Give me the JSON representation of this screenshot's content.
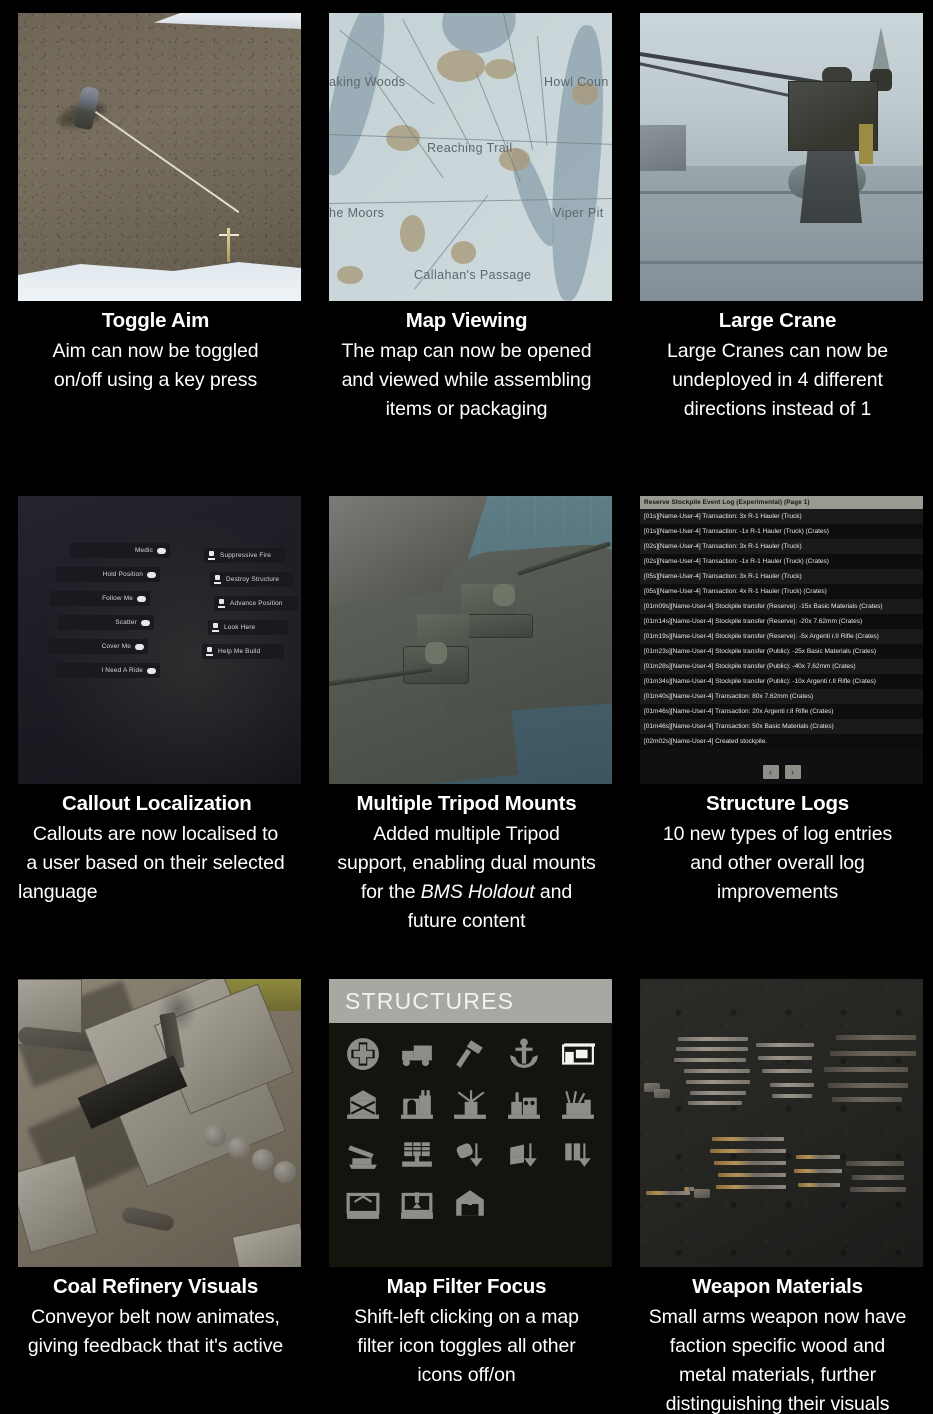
{
  "page": {
    "title": "Patch Notes Feature Highlights",
    "background_color": "#000000",
    "text_color": "#ffffff"
  },
  "cards": [
    {
      "id": "toggle-aim",
      "title": "Toggle Aim",
      "body_lines": [
        "Aim can now be toggled",
        "on/off using a key press"
      ],
      "body": "Aim can now be toggled on/off using a key press",
      "media": "top-down screenshot of a soldier aiming with a line-of-aim indicator on rocky ground"
    },
    {
      "id": "map-viewing",
      "title": "Map Viewing",
      "body_lines": [
        "The map can now be opened",
        "and viewed while assembling",
        "items or packaging"
      ],
      "body": "The map can now be opened and viewed while assembling items or packaging",
      "media": "in-game region map",
      "map_labels": [
        "aking Woods",
        "Howl Coun",
        "Reaching Trail",
        "he Moors",
        "Viper Pit",
        "Callahan's Passage"
      ]
    },
    {
      "id": "large-crane",
      "title": "Large Crane",
      "body_lines": [
        "Large Cranes can now be",
        "undeployed in 4 different",
        "directions instead of 1"
      ],
      "body": "Large Cranes can now be undeployed in 4 different directions instead of 1",
      "media": "large crane on a snowy platform"
    },
    {
      "id": "callout-localization",
      "title": "Callout Localization",
      "title_align": "left",
      "body_lines": [
        "Callouts are now localised to",
        "a user based on their selected",
        "language"
      ],
      "body": "Callouts are now localised to a user based on their selected language",
      "media": "radial callout wheel menu",
      "callouts_left": [
        "Medic",
        "Hold Position",
        "Follow Me",
        "Scatter",
        "Cover Me",
        "I Need A Ride"
      ],
      "callouts_right": [
        "Suppressive Fire",
        "Destroy Structure",
        "Advance Position",
        "Look Here",
        "Help Me Build"
      ]
    },
    {
      "id": "multiple-tripod-mounts",
      "title": "Multiple Tripod Mounts",
      "body_lines": [
        "Added multiple Tripod",
        "support, enabling dual mounts",
        "for the ",
        " and",
        "future content"
      ],
      "body_pre": "Added multiple Tripod support, enabling dual mounts for the ",
      "body_italic": "BMS Holdout",
      "body_post": " and future content",
      "media": "two gunners manning tripod mounts on an armoured vehicle by the sea"
    },
    {
      "id": "structure-logs",
      "title": "Structure Logs",
      "body_lines": [
        "10 new types of log entries",
        "and other overall log",
        "improvements"
      ],
      "body": "10 new types of log entries and other overall log improvements",
      "media": "reserve stockpile event log panel",
      "log": {
        "header": "Reserve Stockpile Event Log (Experimental) (Page 1)",
        "entries": [
          "[01s][Name-User-4] Transaction: 3x R-1 Hauler (Truck)",
          "[01s][Name-User-4] Transaction: -1x R-1 Hauler (Truck) (Crates)",
          "[02s][Name-User-4] Transaction: 3x R-1 Hauler (Truck)",
          "[02s][Name-User-4] Transaction: -1x R-1 Hauler (Truck) (Crates)",
          "[05s][Name-User-4] Transaction: 3x R-1 Hauler (Truck)",
          "[05s][Name-User-4] Transaction: 4x R-1 Hauler (Truck) (Crates)",
          "[01m09s][Name-User-4] Stockpile transfer (Reserve): -15x Basic Materials (Crates)",
          "[01m14s][Name-User-4] Stockpile transfer (Reserve): -20x 7.62mm (Crates)",
          "[01m19s][Name-User-4] Stockpile transfer (Reserve): -5x Argenti r.II Rifle (Crates)",
          "[01m23s][Name-User-4] Stockpile transfer (Public): -25x Basic Materials (Crates)",
          "[01m28s][Name-User-4] Stockpile transfer (Public): -40x 7.62mm (Crates)",
          "[01m34s][Name-User-4] Stockpile transfer (Public): -10x Argenti r.II Rifle (Crates)",
          "[01m40s][Name-User-4] Transaction: 80x 7.62mm (Crates)",
          "[01m46s][Name-User-4] Transaction: 20x Argenti r.II Rifle (Crates)",
          "[01m46s][Name-User-4] Transaction: 50x Basic Materials (Crates)",
          "[02m02s][Name-User-4] Created stockpile."
        ],
        "prev_label": "‹",
        "next_label": "›"
      }
    },
    {
      "id": "coal-refinery-visuals",
      "title": "Coal Refinery Visuals",
      "body_lines": [
        "Conveyor belt now animates,",
        "giving feedback that it's active"
      ],
      "body": "Conveyor belt now animates, giving feedback that it's active",
      "media": "top-down view of a coal refinery with smoking chimney"
    },
    {
      "id": "map-filter-focus",
      "title": "Map Filter Focus",
      "body_lines": [
        "Shift-left clicking on a map",
        "filter icon toggles all other",
        "icons off/on"
      ],
      "body": "Shift-left clicking on a map filter icon toggles all other icons off/on",
      "media": "structures map-filter icon panel",
      "panel": {
        "header": "STRUCTURES",
        "icons": [
          {
            "name": "medical-cross-icon",
            "highlighted": false
          },
          {
            "name": "truck-icon",
            "highlighted": false
          },
          {
            "name": "hammer-icon",
            "highlighted": false
          },
          {
            "name": "anchor-icon",
            "highlighted": false
          },
          {
            "name": "storage-depot-icon",
            "highlighted": true
          },
          {
            "name": "bunker-base-icon",
            "highlighted": false
          },
          {
            "name": "factory-icon",
            "highlighted": false
          },
          {
            "name": "radio-antenna-icon",
            "highlighted": false
          },
          {
            "name": "refinery-icon",
            "highlighted": false
          },
          {
            "name": "construction-yard-icon",
            "highlighted": false
          },
          {
            "name": "artillery-gun-icon",
            "highlighted": false
          },
          {
            "name": "solar-array-icon",
            "highlighted": false
          },
          {
            "name": "resource-drop-icon",
            "highlighted": false
          },
          {
            "name": "materials-drop-icon",
            "highlighted": false
          },
          {
            "name": "crate-drop-icon",
            "highlighted": false
          },
          {
            "name": "shipyard-icon",
            "highlighted": false
          },
          {
            "name": "dry-dock-icon",
            "highlighted": false
          },
          {
            "name": "garage-icon",
            "highlighted": false
          }
        ]
      }
    },
    {
      "id": "weapon-materials",
      "title": "Weapon Materials",
      "body_lines": [
        "Small arms weapon now have",
        "faction specific wood and",
        "metal materials, further",
        "distinguishing their visuals"
      ],
      "body": "Small arms weapon now have faction specific wood and metal materials, further distinguishing their visuals",
      "media": "array of small arms weapons laid out on a dark surface"
    }
  ]
}
